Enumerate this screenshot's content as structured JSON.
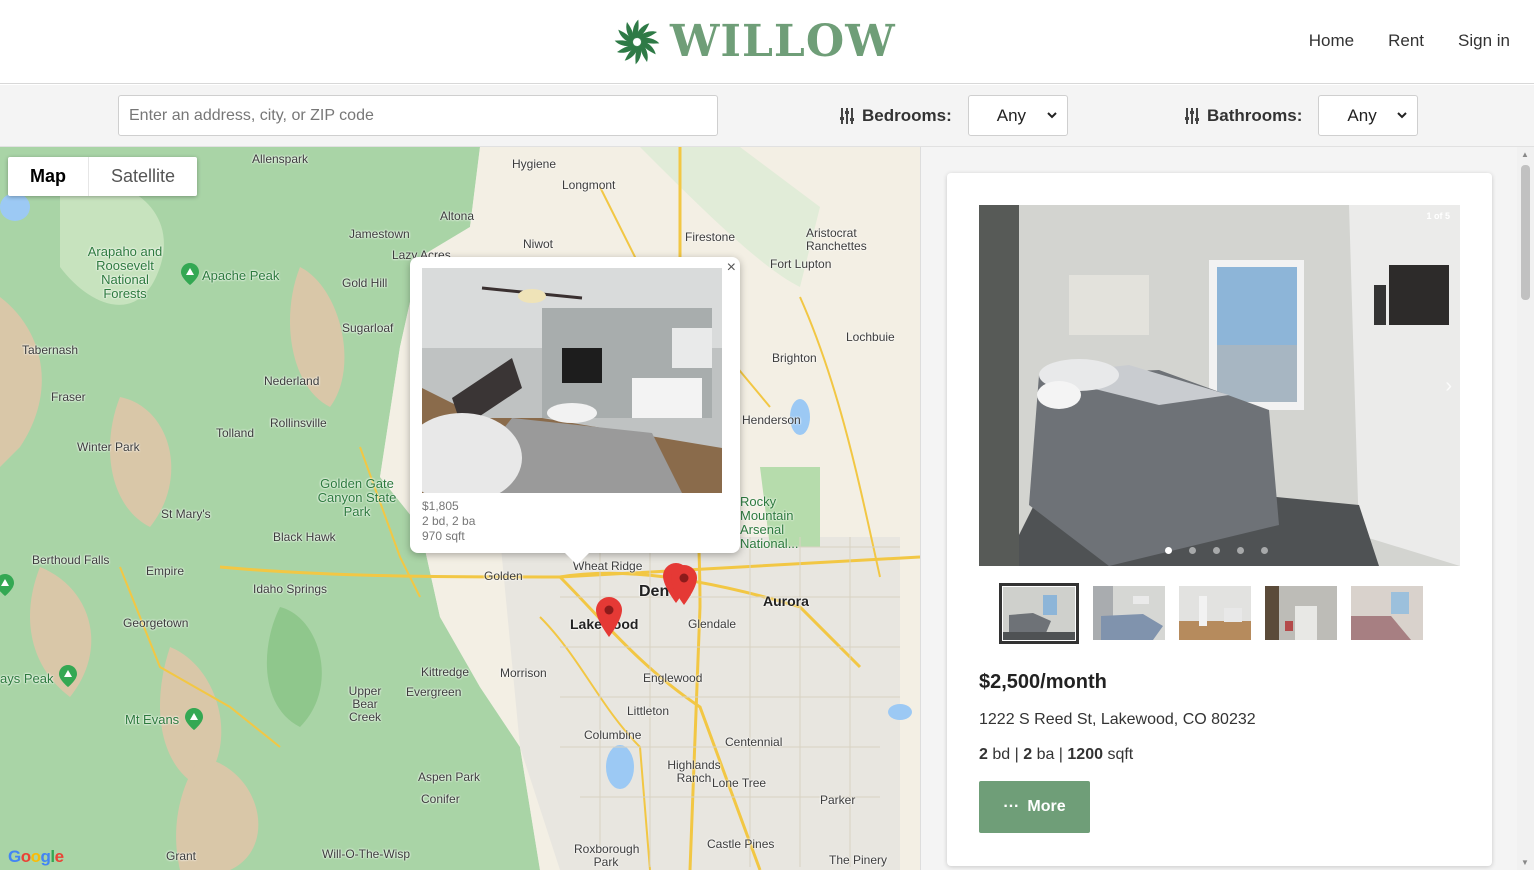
{
  "header": {
    "logo_text": "WILLOW",
    "nav": [
      "Home",
      "Rent",
      "Sign in"
    ],
    "brand_color": "#6f9e78"
  },
  "search": {
    "placeholder": "Enter an address, city, or ZIP code",
    "bedrooms_label": "Bedrooms:",
    "bedrooms_value": "Any",
    "bathrooms_label": "Bathrooms:",
    "bathrooms_value": "Any"
  },
  "map": {
    "toggle": [
      "Map",
      "Satellite"
    ],
    "popup": {
      "close": "×",
      "price": "$1,805",
      "beds_baths": "2 bd, 2 ba",
      "sqft": "970 sqft"
    },
    "places": [
      "Allenspark",
      "Hygiene",
      "Longmont",
      "Altona",
      "Jamestown",
      "Niwot",
      "Firestone",
      "Aristocrat Ranchettes",
      "Fort Lupton",
      "Gold Hill",
      "Lazy Acres",
      "Sugarloaf",
      "Lochbuie",
      "Brighton",
      "Tabernash",
      "Nederland",
      "Fraser",
      "Rollinsville",
      "Tolland",
      "Winter Park",
      "Henderson",
      "St Mary's",
      "Black Hawk",
      "Berthoud Falls",
      "Empire",
      "Idaho Springs",
      "Golden",
      "Wheat Ridge",
      "Denver",
      "Aurora",
      "Georgetown",
      "Lakewood",
      "Glendale",
      "Kittredge",
      "Morrison",
      "Englewood",
      "Evergreen",
      "Upper Bear Creek",
      "Littleton",
      "Columbine",
      "Centennial",
      "Highlands Ranch",
      "Lone Tree",
      "Aspen Park",
      "Conifer",
      "Parker",
      "Grant",
      "Will-O-The-Wisp",
      "Roxborough Park",
      "Castle Pines",
      "The Pinery"
    ],
    "parks": [
      "Arapaho and Roosevelt National Forests",
      "Apache Peak",
      "Golden Gate Canyon State Park",
      "Rocky Mountain Arsenal National...",
      "Mt Evans",
      "ays Peak"
    ],
    "google": "Google"
  },
  "listing": {
    "counter": "1 of 5",
    "price": "$2,500/month",
    "address": "1222 S Reed St, Lakewood, CO 80232",
    "beds": "2",
    "beds_unit": "bd",
    "baths": "2",
    "baths_unit": "ba",
    "sqft": "1200",
    "sqft_unit": "sqft",
    "more_label": "More",
    "photo_count": 5
  }
}
